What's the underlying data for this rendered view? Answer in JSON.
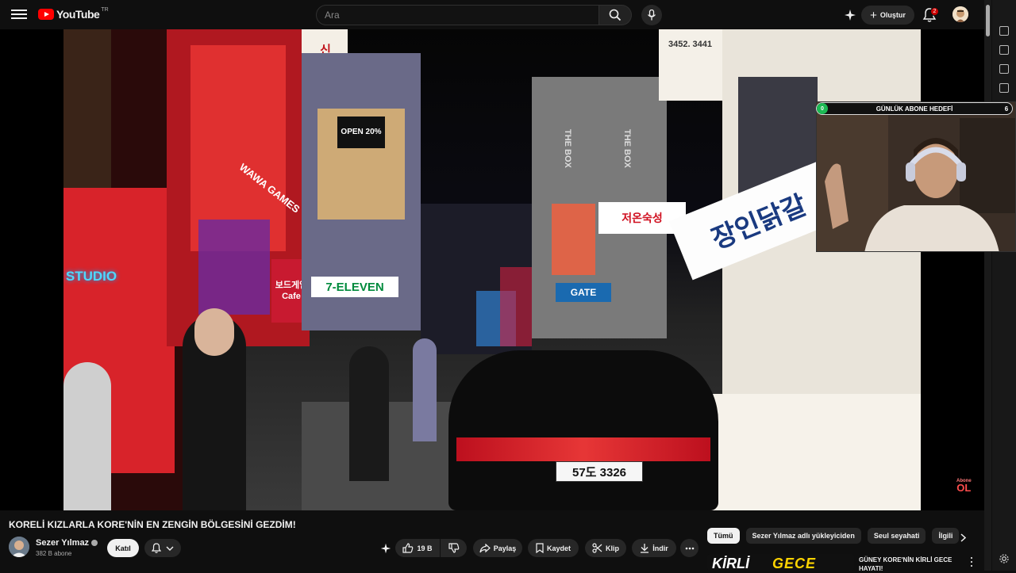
{
  "header": {
    "logo_text": "YouTube",
    "logo_country": "TR",
    "search_placeholder": "Ara",
    "create_label": "Oluştur",
    "notification_count": "2"
  },
  "video": {
    "overlay": {
      "goal_label": "GÜNLÜK ABONE HEDEFİ",
      "goal_current": "0",
      "goal_target": "6",
      "subscribe_line1": "Abone",
      "subscribe_line2": "OL"
    },
    "scene_signs": {
      "store": "7-ELEVEN",
      "wawa": "WAWA GAMES",
      "studio": "STUDIO",
      "open": "OPEN 20%",
      "cafe": "보드게임 Cafe",
      "korean_big": "장인닭갈",
      "korean_shop": "저온숙성",
      "box": "THE BOX",
      "phone": "3452. 3441",
      "gate": "GATE",
      "plate": "57도 3326"
    }
  },
  "meta": {
    "title": "KORELİ KIZLARLA KORE'NİN EN ZENGİN BÖLGESİNİ GEZDİM!",
    "channel_name": "Sezer Yılmaz",
    "subscribers": "382 B abone",
    "join_label": "Katıl",
    "like_count": "19 B",
    "share_label": "Paylaş",
    "save_label": "Kaydet",
    "clip_label": "Klip",
    "download_label": "İndir"
  },
  "chips": [
    "Tümü",
    "Sezer Yılmaz adlı yükleyiciden",
    "Seul seyahati",
    "İlgili"
  ],
  "recommendation": {
    "thumb_text_white": "KİRLİ",
    "thumb_text_yellow": "GECE",
    "title": "GÜNEY KORE'NİN KİRLİ GECE HAYATI!"
  },
  "colors": {
    "background": "#0f0f0f",
    "accent_red": "#ff0000",
    "button_bg": "#272727",
    "goal_green": "#1db954"
  }
}
